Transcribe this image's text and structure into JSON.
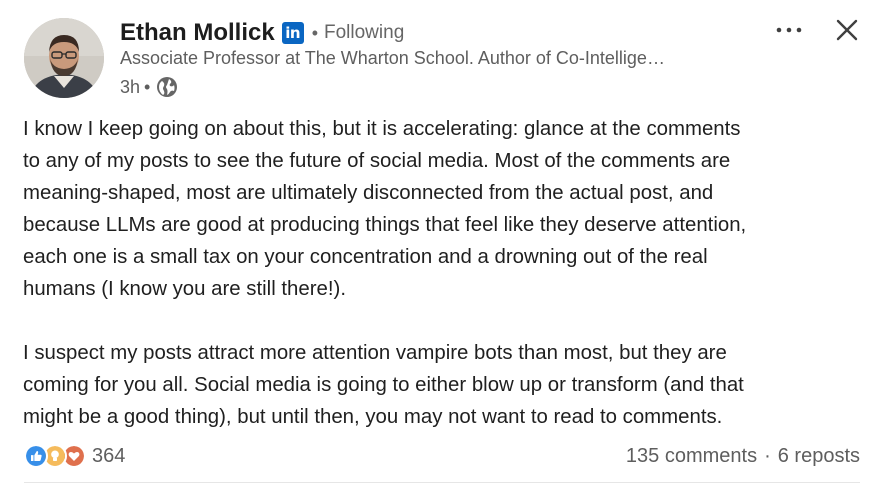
{
  "author": {
    "name": "Ethan Mollick",
    "badge": "in",
    "follow_status": "Following",
    "headline": "Associate Professor at The Wharton School. Author of Co-Intellige…",
    "time": "3h",
    "visibility_icon": "globe-icon",
    "separator": "•"
  },
  "post": {
    "paragraph1": [
      "I know I keep going on about this, but it is accelerating: glance at the comments",
      "to any of my posts to see the future of social media. Most of the comments are",
      "meaning-shaped, most are ultimately disconnected from the actual post, and",
      "because LLMs are good at producing things that feel like they deserve attention,",
      "each one is a small tax on your concentration and a drowning out of the real",
      "humans (I know you are still there!)."
    ],
    "paragraph2": [
      "I suspect my posts attract more attention vampire bots than most, but they are",
      "coming for you all. Social media is going to either blow up or transform (and that",
      "might be a good thing), but until then, you may not want to read to comments."
    ]
  },
  "social": {
    "reaction_icons": [
      "like-icon",
      "insightful-icon",
      "love-icon"
    ],
    "reaction_count": "364",
    "comments": "135 comments",
    "separator": "·",
    "reposts": "6 reposts"
  },
  "controls": {
    "more_icon": "more-horizontal-icon",
    "close_icon": "close-icon"
  },
  "colors": {
    "linkedin_blue": "#0a66c2",
    "like_blue": "#378fe9",
    "insightful_yellow": "#f5bb5c",
    "love_red": "#df704d",
    "secondary_text": "#5e5e5e"
  }
}
